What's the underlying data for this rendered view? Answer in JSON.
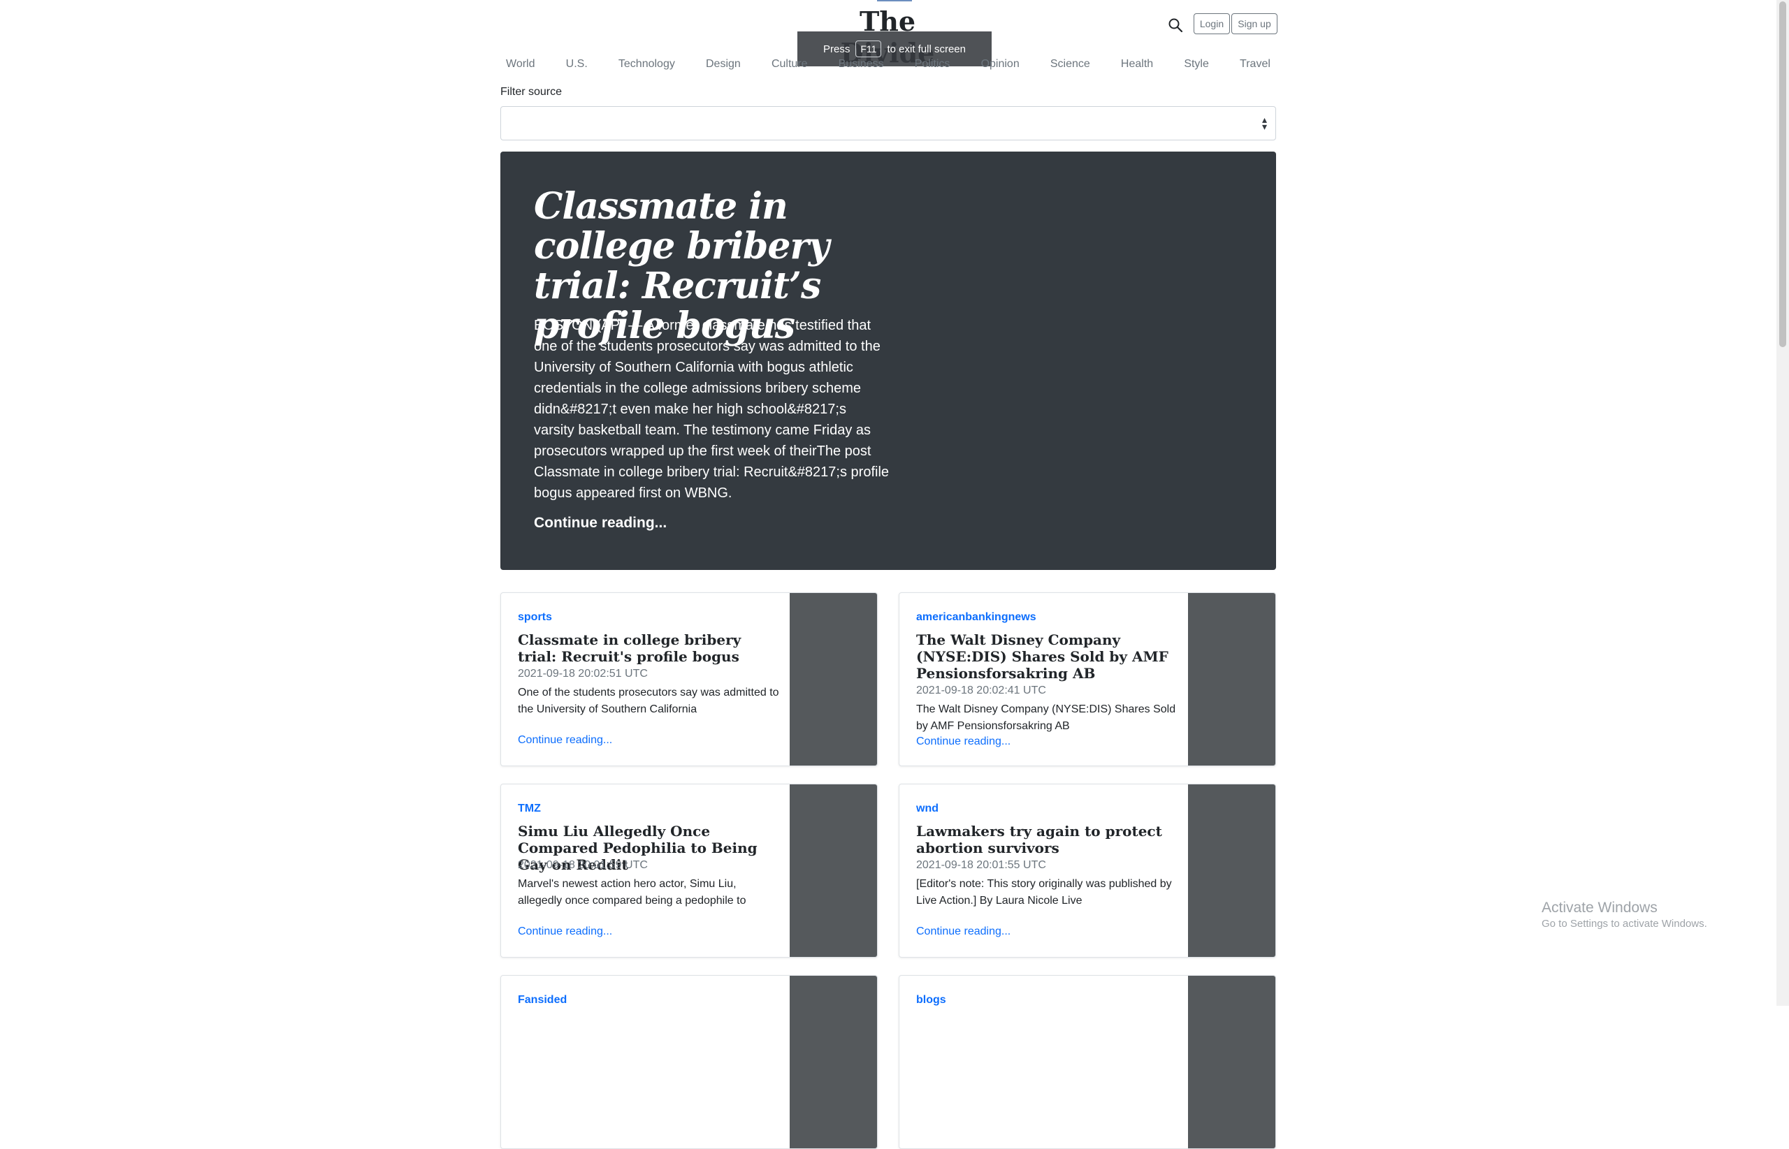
{
  "header": {
    "brand": "The Divide",
    "login_label": "Login",
    "signup_label": "Sign up"
  },
  "fullscreen_notice": {
    "prefix": "Press",
    "key": "F11",
    "suffix": "to exit full screen"
  },
  "nav": {
    "items": [
      "World",
      "U.S.",
      "Technology",
      "Design",
      "Culture",
      "Business",
      "Politics",
      "Opinion",
      "Science",
      "Health",
      "Style",
      "Travel"
    ]
  },
  "filter": {
    "label": "Filter source",
    "value": ""
  },
  "hero": {
    "title": "Classmate in college bribery trial: Recruit’s profile bogus",
    "text": "BOSTON (AP) — A former classmate has testified that one of the students prosecutors say was admitted to the University of Southern California with bogus athletic credentials in the college admissions bribery scheme didn&#8217;t even make her high school&#8217;s varsity basketball team. The testimony came Friday as prosecutors wrapped up the first week of theirThe post Classmate in college bribery trial: Recruit&#8217;s profile bogus appeared first on WBNG.",
    "link": "Continue reading..."
  },
  "cards": [
    {
      "source": "sports",
      "title": "Classmate in college bribery trial: Recruit's profile bogus",
      "date": "2021-09-18 20:02:51 UTC",
      "excerpt": "One of the students prosecutors say was admitted to the University of Southern California",
      "link": "Continue reading..."
    },
    {
      "source": "americanbankingnews",
      "title": "The Walt Disney Company (NYSE:DIS) Shares Sold by AMF Pensionsforsakring AB",
      "date": "2021-09-18 20:02:41 UTC",
      "excerpt": "The Walt Disney Company (NYSE:DIS) Shares Sold by AMF Pensionsforsakring AB",
      "link": "Continue reading..."
    },
    {
      "source": "TMZ",
      "title": "Simu Liu Allegedly Once Compared Pedophilia to Being Gay on Reddit",
      "date": "2021-09-18 20:01:59 UTC",
      "excerpt": "Marvel's newest action hero actor, Simu Liu, allegedly once compared being a pedophile to",
      "link": "Continue reading..."
    },
    {
      "source": "wnd",
      "title": "Lawmakers try again to protect abortion survivors",
      "date": "2021-09-18 20:01:55 UTC",
      "excerpt": "[Editor's note: This story originally was published by Live Action.] By Laura Nicole Live",
      "link": "Continue reading..."
    },
    {
      "source": "Fansided",
      "title": "",
      "date": "",
      "excerpt": "",
      "link": ""
    },
    {
      "source": "blogs",
      "title": "",
      "date": "",
      "excerpt": "",
      "link": ""
    }
  ],
  "watermark": {
    "title": "Activate Windows",
    "subtitle": "Go to Settings to activate Windows."
  },
  "colors": {
    "accent": "#0d6efd",
    "hero_bg": "#343a40",
    "thumb_bg": "#55595c"
  }
}
